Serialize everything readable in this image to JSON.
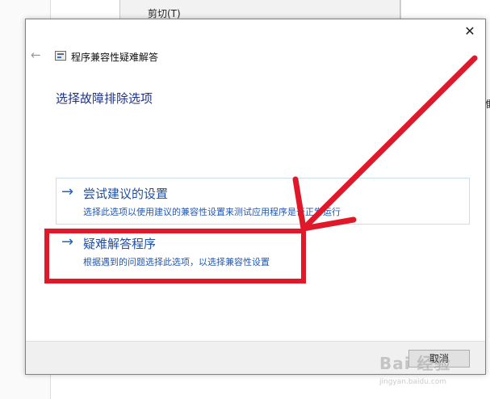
{
  "background": {
    "menu_item": "剪切(T)",
    "right_fragment": "推"
  },
  "dialog": {
    "title": "程序兼容性疑难解答",
    "heading": "选择故障排除选项",
    "options": [
      {
        "title": "尝试建议的设置",
        "description": "选择此选项以使用建议的兼容性设置来测试应用程序是否正常运行"
      },
      {
        "title": "疑难解答程序",
        "description": "根据遇到的问题选择此选项，以选择兼容性设置"
      }
    ],
    "cancel_label": "取消"
  },
  "watermark": {
    "text": "Bai 经验",
    "url": "jingyan.baidu.com"
  },
  "colors": {
    "accent": "#1d64c4",
    "annotation_red": "#e0192a",
    "heading": "#1e3287"
  },
  "icons": {
    "close": "close-icon",
    "back": "back-arrow-icon",
    "option_arrow": "right-arrow-icon"
  }
}
